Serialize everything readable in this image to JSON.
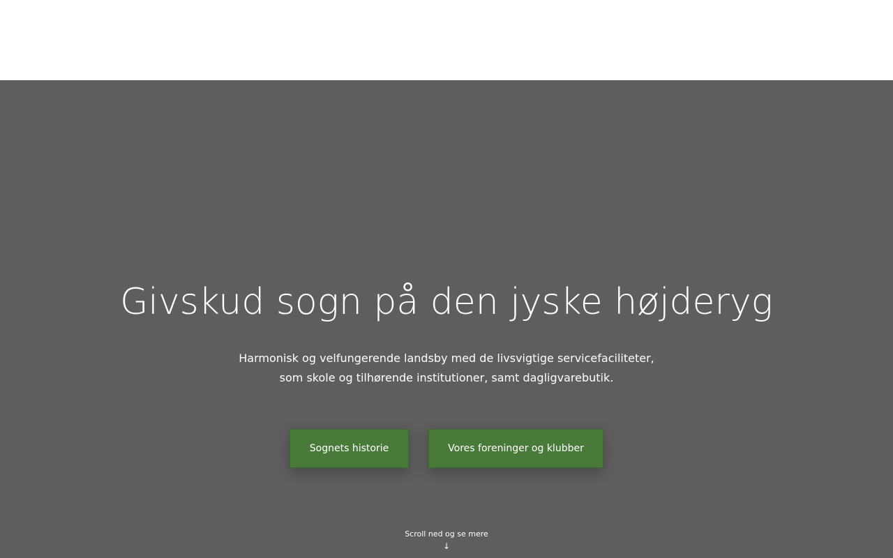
{
  "hero": {
    "title": "Givskud sogn på den jyske højderyg",
    "subtitle_line1": "Harmonisk og velfungerende landsby med de livsvigtige servicefaciliteter,",
    "subtitle_line2": "som skole og tilhørende institutioner, samt dagligvarebutik.",
    "buttons": [
      {
        "label": "Sognets historie"
      },
      {
        "label": "Vores foreninger og klubber"
      }
    ],
    "scroll_hint": "Scroll ned og se mere",
    "scroll_arrow": "↓"
  },
  "colors": {
    "hero_background": "#5e5e5e",
    "button_green": "#487b3a",
    "header_background": "#ffffff"
  }
}
